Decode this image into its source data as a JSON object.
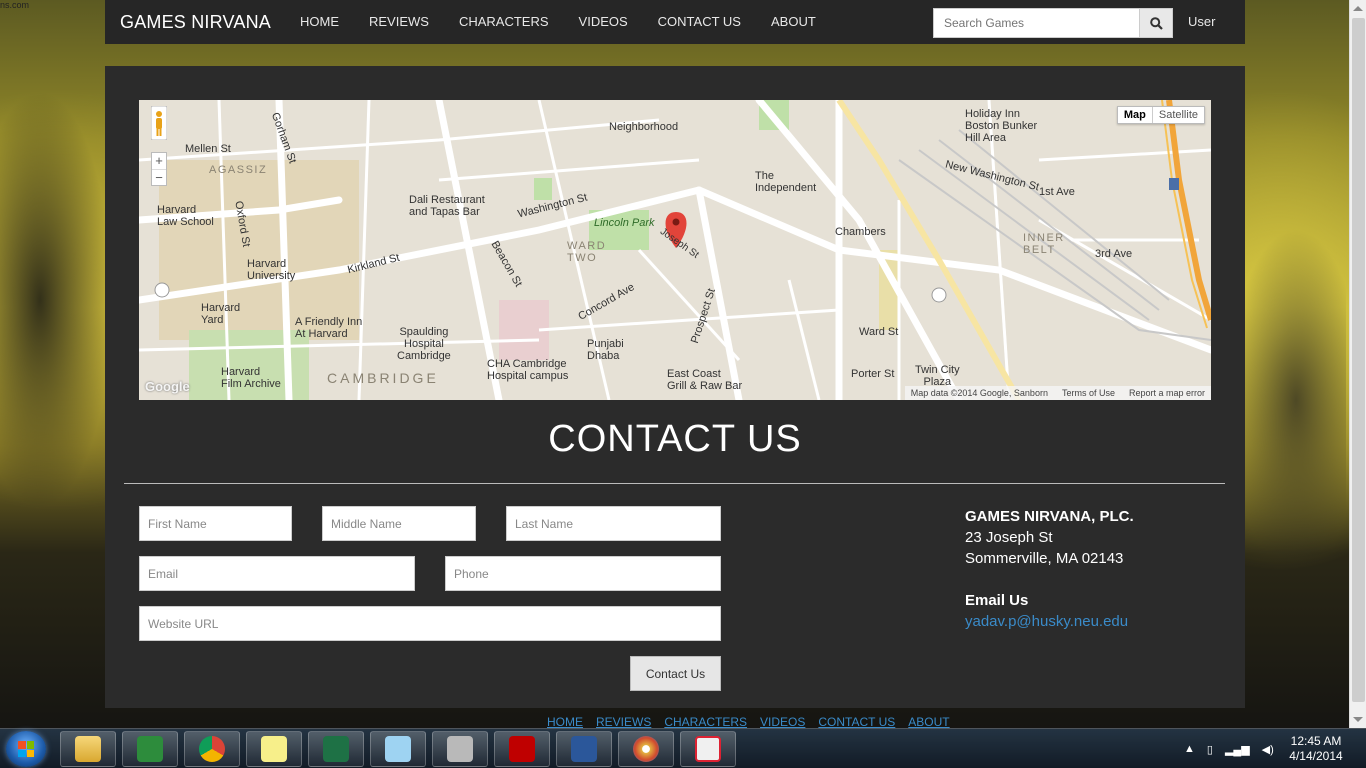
{
  "corner_text": "ns.com",
  "navbar": {
    "brand": "GAMES NIRVANA",
    "links": [
      "HOME",
      "REVIEWS",
      "CHARACTERS",
      "VIDEOS",
      "CONTACT US",
      "ABOUT"
    ],
    "search_placeholder": "Search Games",
    "search_icon": "search-icon",
    "user": "User"
  },
  "map": {
    "type_active": "Map",
    "type_inactive": "Satellite",
    "zoom_in": "+",
    "zoom_out": "−",
    "footer": [
      "Map data ©2014 Google, Sanborn",
      "Terms of Use",
      "Report a map error"
    ],
    "google": "Google",
    "labels": {
      "neighborhood": "Neighborhood",
      "the_independent": "The\nIndependent",
      "holiday_inn": "Holiday Inn\nBoston Bunker\nHill Area",
      "agassiz": "AGASSIZ",
      "mellen": "Mellen St",
      "harvard_law": "Harvard\nLaw School",
      "harvard_univ": "Harvard\nUniversity",
      "harvard_yard": "Harvard\nYard",
      "harvard_film": "Harvard\nFilm Archive",
      "a_friendly_inn": "A Friendly Inn\nAt Harvard",
      "cambridge": "CAMBRIDGE",
      "dali": "Dali Restaurant\nand Tapas Bar",
      "washington": "Washington St",
      "lincoln_park": "Lincoln Park",
      "ward_two": "WARD\nTWO",
      "kirkland": "Kirkland St",
      "beacon": "Beacon St",
      "spaulding": "Spaulding\nHospital\nCambridge",
      "cha": "CHA Cambridge\nHospital campus",
      "punjabi": "Punjabi\nDhaba",
      "east_coast": "East Coast\nGrill & Raw Bar",
      "chambers": "Chambers",
      "inner_belt": "INNER\nBELT",
      "twin_city": "Twin City\nPlaza",
      "prospect": "Prospect St",
      "new_washington": "New Washington St",
      "third_ave": "3rd Ave",
      "first_ave": "1st Ave",
      "oxford": "Oxford St",
      "joseph": "Joseph St",
      "porter": "Porter St",
      "ward_st": "Ward St",
      "gorham": "Gorham St",
      "concord": "Concord Ave"
    }
  },
  "contact": {
    "heading": "CONTACT US",
    "first_name": "First Name",
    "middle_name": "Middle Name",
    "last_name": "Last Name",
    "email": "Email",
    "phone": "Phone",
    "website": "Website URL",
    "submit": "Contact Us"
  },
  "address": {
    "company": "GAMES NIRVANA, PLC.",
    "street": "23 Joseph St",
    "city": "Sommerville, MA 02143",
    "email_heading": "Email Us",
    "email": "yadav.p@husky.neu.edu"
  },
  "footer_links": [
    "HOME",
    "REVIEWS",
    "CHARACTERS",
    "VIDEOS",
    "CONTACT US",
    "ABOUT"
  ],
  "taskbar": {
    "apps": [
      "file-explorer",
      "visual-studio",
      "chrome",
      "sticky-notes",
      "excel",
      "notepad",
      "network-tool",
      "filezilla",
      "word",
      "paint",
      "snipping-tool"
    ],
    "time": "12:45 AM",
    "date": "4/14/2014"
  }
}
